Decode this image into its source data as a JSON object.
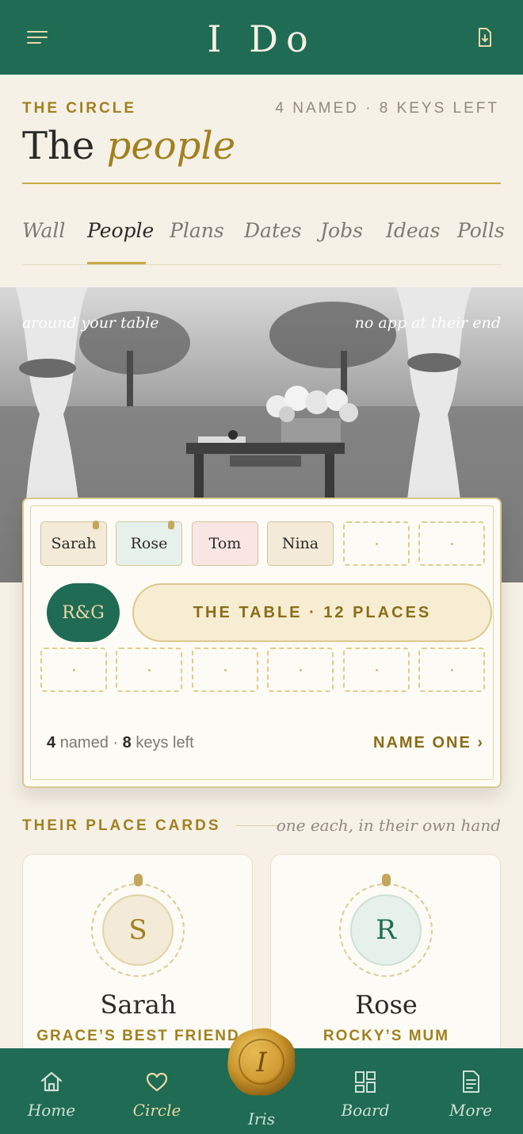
{
  "header": {
    "logo_text": "I Do",
    "menu_icon": "hamburger-icon",
    "save_icon": "download-document-icon"
  },
  "section": {
    "eyebrow": "THE CIRCLE",
    "counter": "4 NAMED · 8 KEYS LEFT",
    "title_plain": "The",
    "title_italic": "people"
  },
  "tabs": [
    {
      "label": "Wall"
    },
    {
      "label": "People",
      "active": true
    },
    {
      "label": "Plans"
    },
    {
      "label": "Dates"
    },
    {
      "label": "Jobs"
    },
    {
      "label": "Ideas"
    },
    {
      "label": "Polls"
    }
  ],
  "hero": {
    "caption_left": "around your table",
    "caption_right": "no app at their end"
  },
  "table": {
    "seats_top": [
      {
        "name": "Sarah",
        "pinned": true,
        "color": "#f3ead7"
      },
      {
        "name": "Rose",
        "pinned": true,
        "color": "#e7f1ec"
      },
      {
        "name": "Tom",
        "pinned": false,
        "color": "#f9e6e3"
      },
      {
        "name": "Nina",
        "pinned": false,
        "color": "#f3ead7"
      },
      {
        "name": "",
        "empty": true
      },
      {
        "name": "",
        "empty": true
      }
    ],
    "seats_bottom": [
      {
        "name": "",
        "empty": true
      },
      {
        "name": "",
        "empty": true
      },
      {
        "name": "",
        "empty": true
      },
      {
        "name": "",
        "empty": true
      },
      {
        "name": "",
        "empty": true
      },
      {
        "name": "",
        "empty": true
      }
    ],
    "monogram": "R&G",
    "table_label": "THE TABLE · 12 PLACES",
    "named_count": "4",
    "named_label": "named",
    "separator": "·",
    "keys_count": "8",
    "keys_label": "keys left",
    "cta": "NAME ONE ›"
  },
  "place_cards": {
    "heading": "THEIR PLACE CARDS",
    "subheading": "one each, in their own hand",
    "cards": [
      {
        "initial": "S",
        "name": "Sarah",
        "role": "GRACE’S BEST FRIEND",
        "circle_color": "#f3ead7",
        "initial_color": "#a1801f"
      },
      {
        "initial": "R",
        "name": "Rose",
        "role": "ROCKY’S MUM",
        "circle_color": "#e7f1ec",
        "initial_color": "#1f6b53"
      }
    ]
  },
  "bottom_nav": {
    "items": [
      {
        "label": "Home",
        "icon": "home-icon"
      },
      {
        "label": "Circle",
        "icon": "heart-icon",
        "active": true
      },
      {
        "label": "Board",
        "icon": "board-icon"
      },
      {
        "label": "More",
        "icon": "document-icon"
      }
    ],
    "center": {
      "label": "Iris",
      "seal_letter": "I",
      "icon": "wax-seal-icon"
    }
  },
  "colors": {
    "primary_green": "#1f6b53",
    "gold": "#a1801f",
    "cream": "#f6f1e6"
  }
}
